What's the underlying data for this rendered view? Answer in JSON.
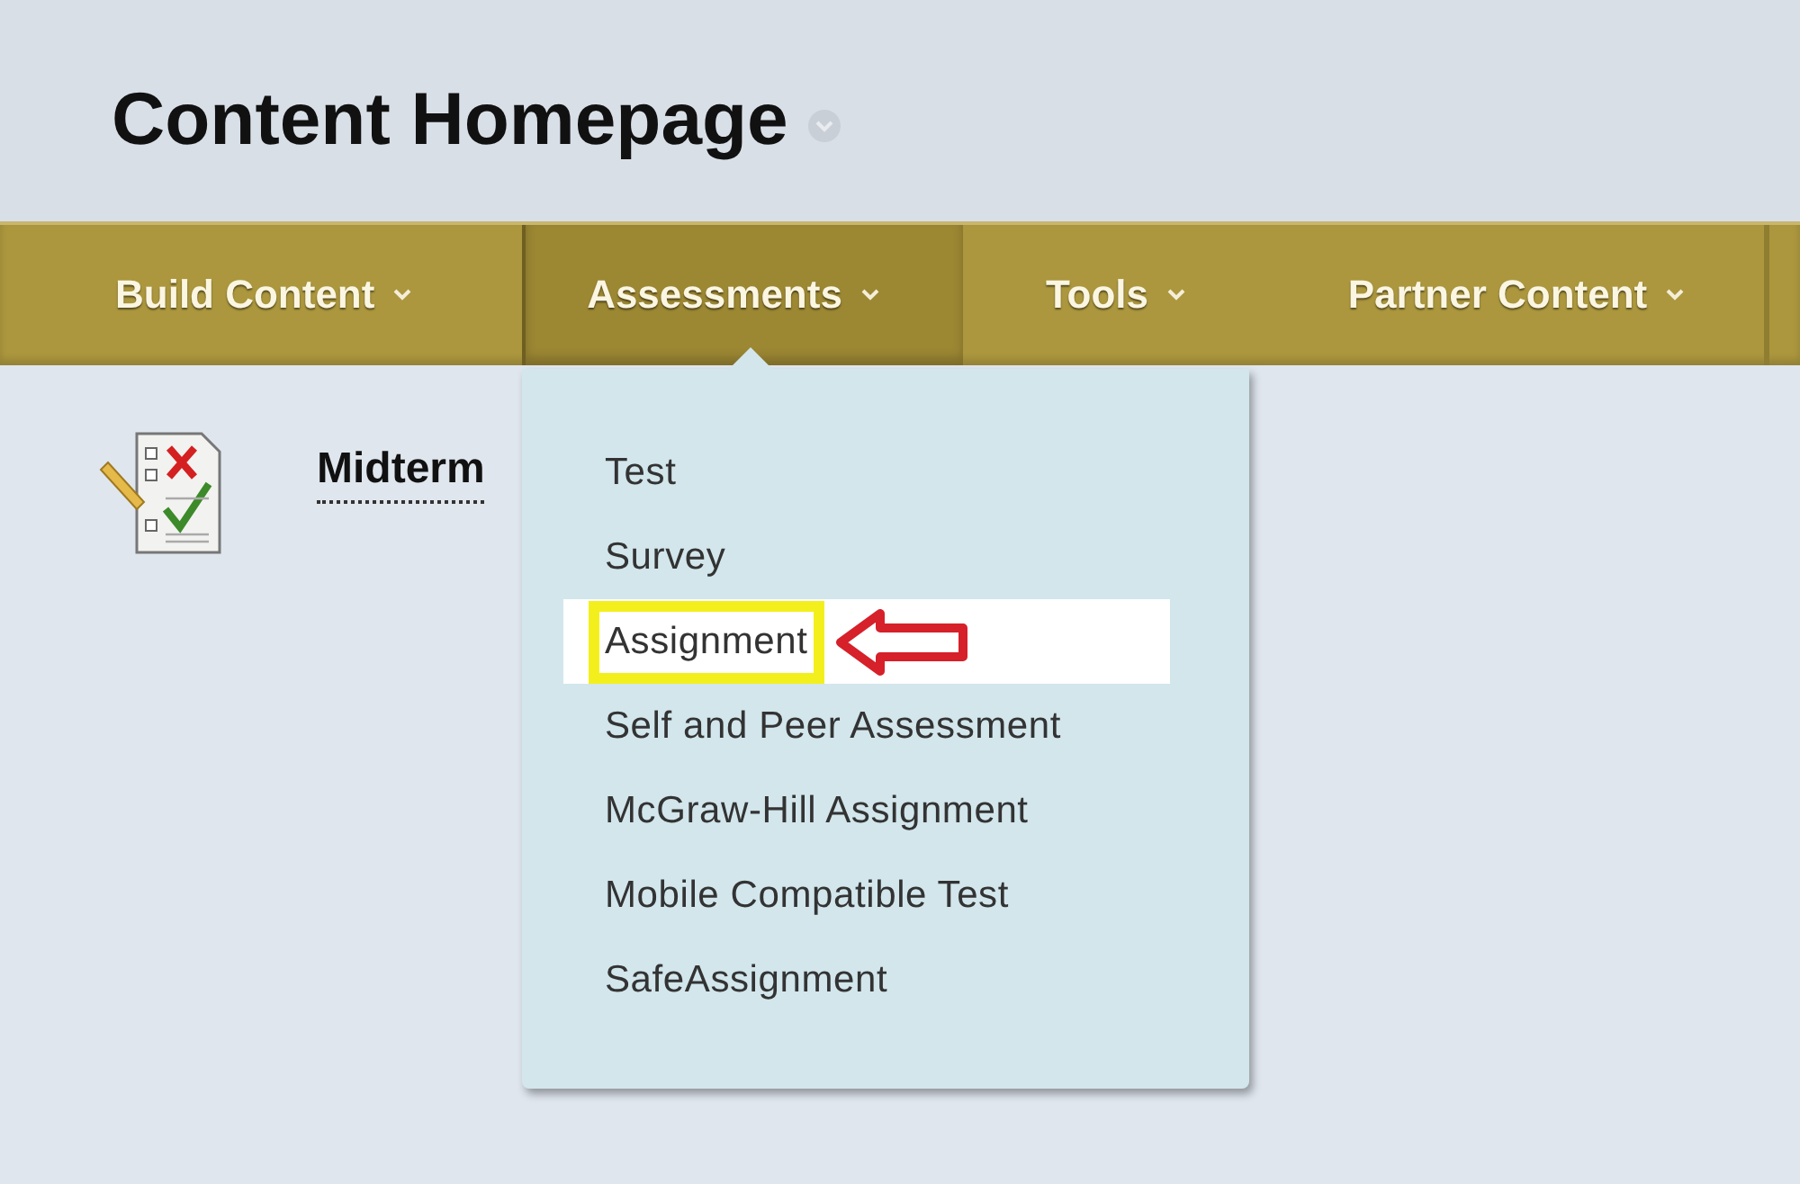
{
  "page": {
    "title": "Content Homepage"
  },
  "menu_bar": [
    {
      "label": "Build Content",
      "selected": false
    },
    {
      "label": "Assessments",
      "selected": true
    },
    {
      "label": "Tools",
      "selected": false
    },
    {
      "label": "Partner Content",
      "selected": false
    }
  ],
  "content_items": [
    {
      "title": "Midterm"
    }
  ],
  "dropdown": {
    "items": [
      {
        "label": "Test",
        "selected": false,
        "callout": false
      },
      {
        "label": "Survey",
        "selected": false,
        "callout": false
      },
      {
        "label": "Assignment",
        "selected": true,
        "callout": true
      },
      {
        "label": "Self and Peer Assessment",
        "selected": false,
        "callout": false
      },
      {
        "label": "McGraw-Hill Assignment",
        "selected": false,
        "callout": false
      },
      {
        "label": "Mobile Compatible Test",
        "selected": false,
        "callout": false
      },
      {
        "label": "SafeAssignment",
        "selected": false,
        "callout": false
      }
    ]
  }
}
